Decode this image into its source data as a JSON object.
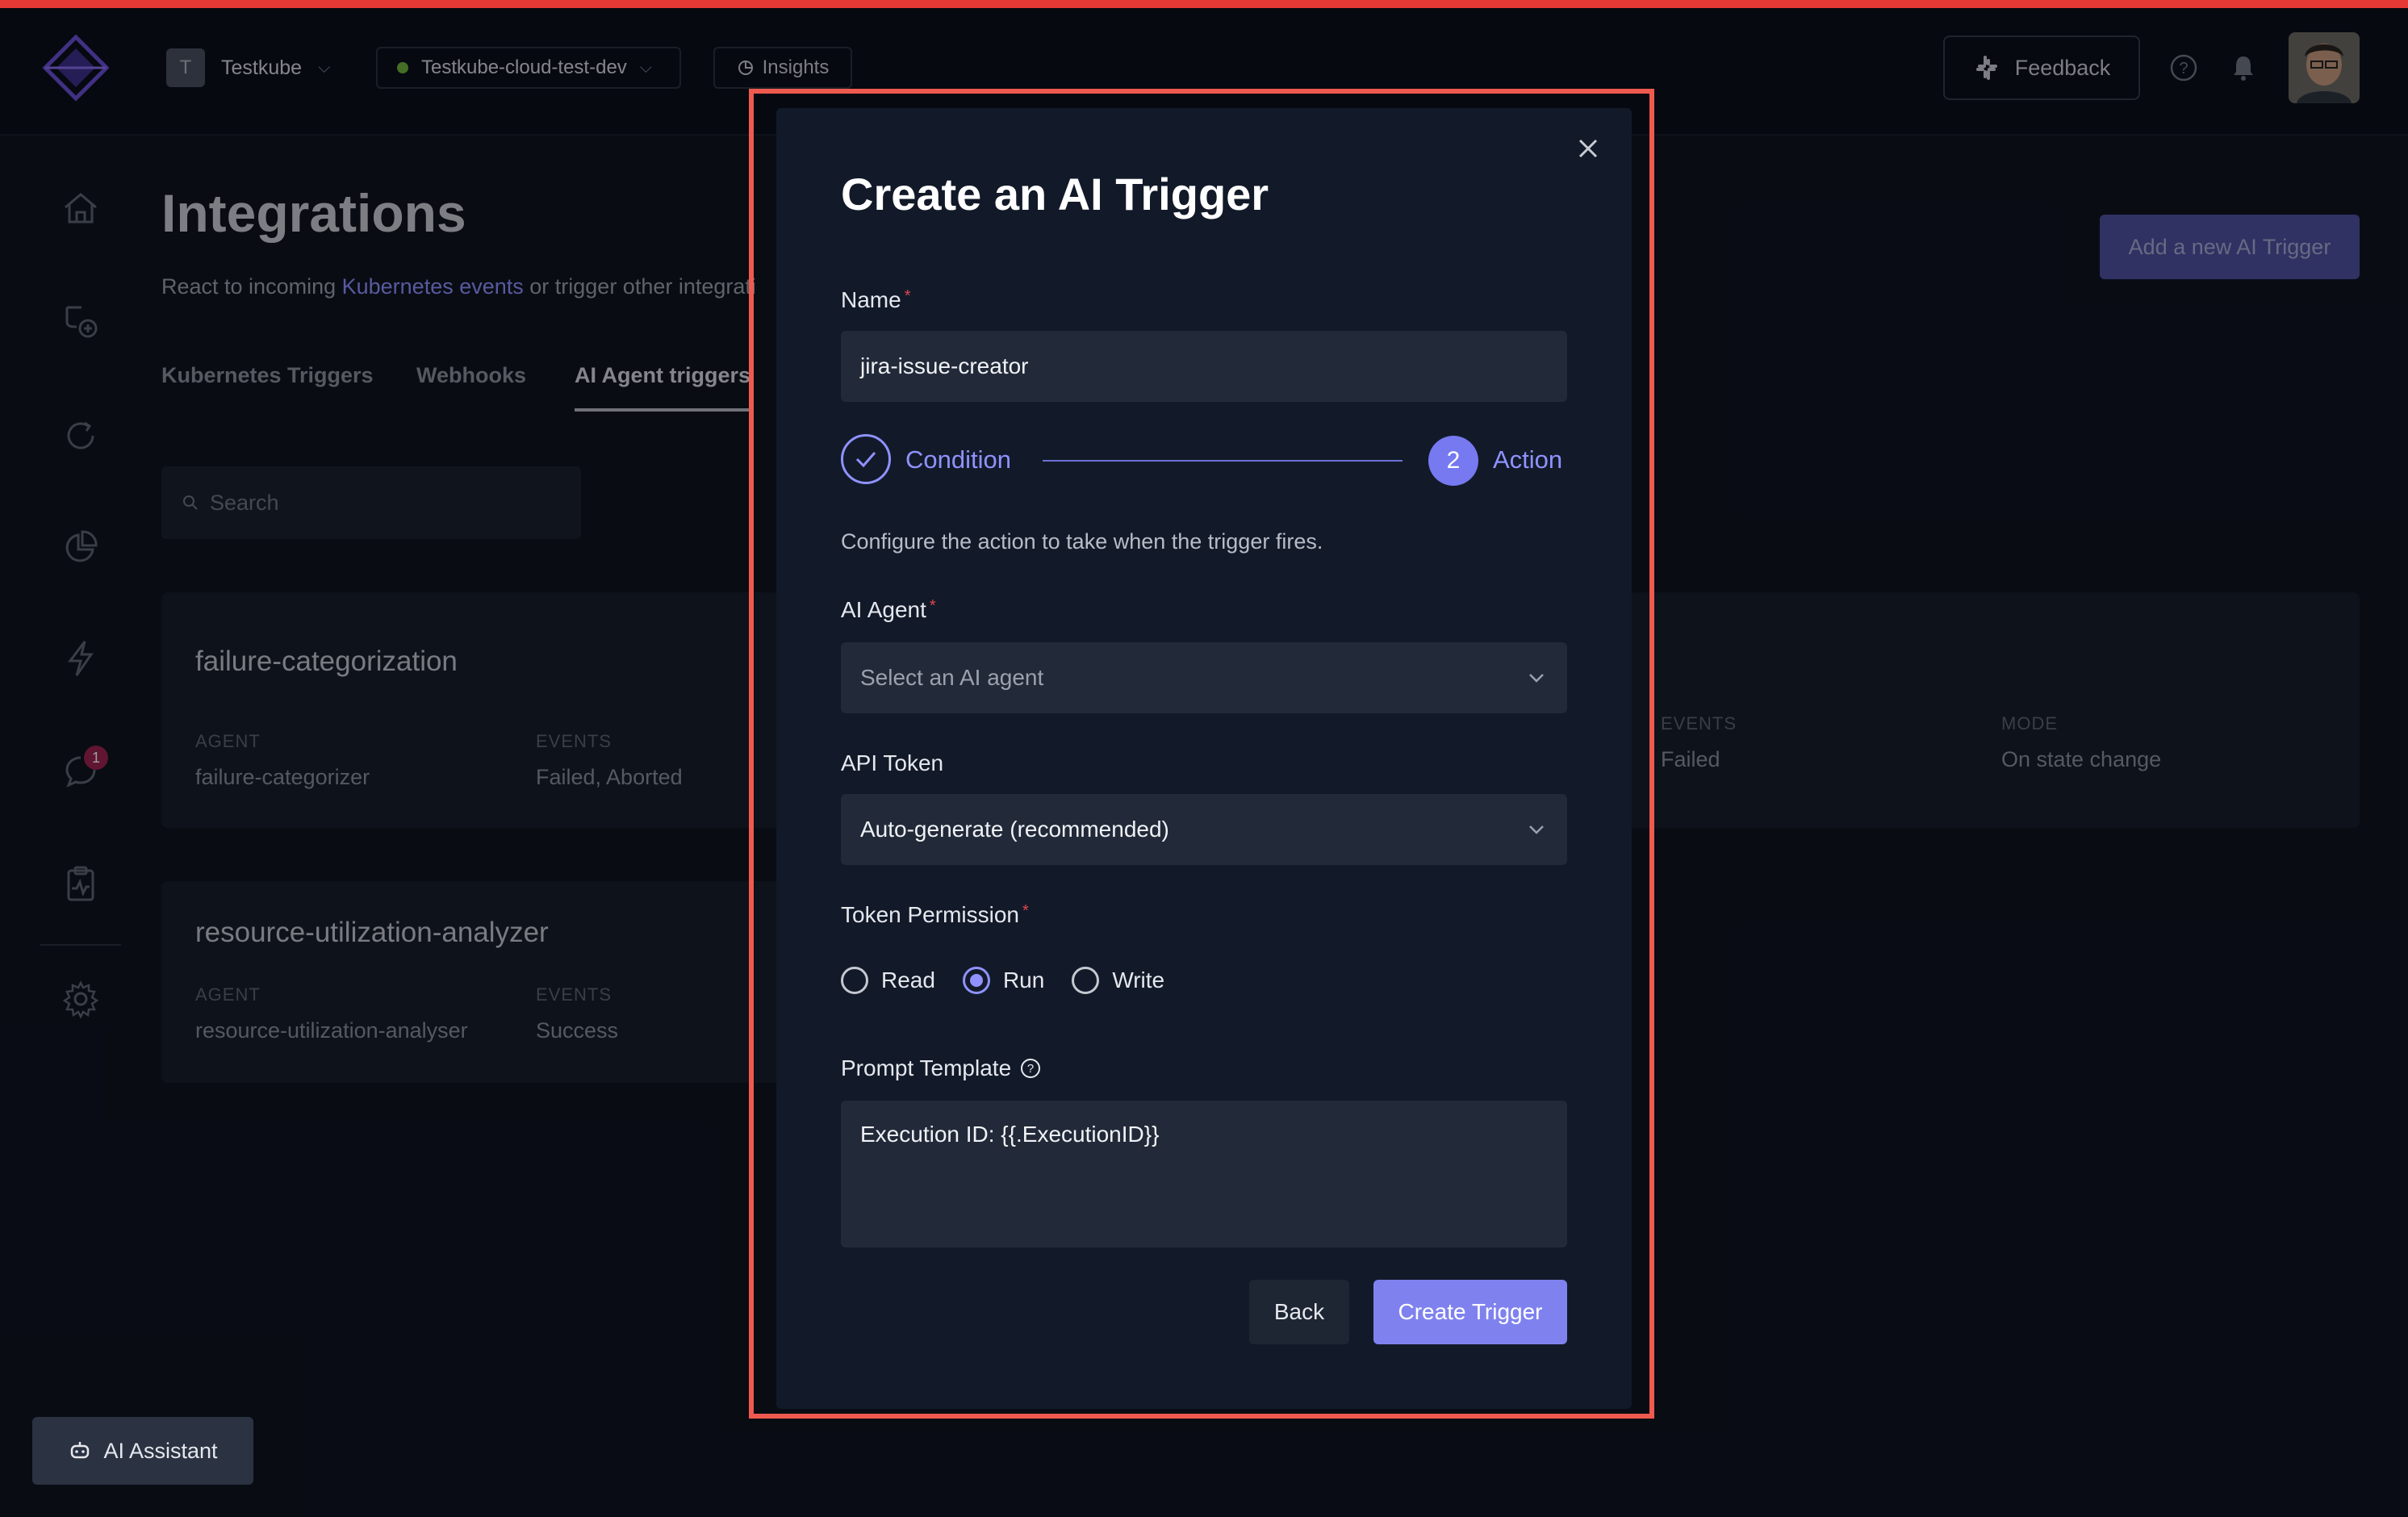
{
  "header": {
    "org": {
      "avatar_letter": "T",
      "name": "Testkube"
    },
    "environment": {
      "name": "Testkube-cloud-test-dev",
      "status_color": "#6fb23c"
    },
    "insights_label": "Insights",
    "feedback_label": "Feedback"
  },
  "sidebar": {
    "items": [
      {
        "icon": "home-icon"
      },
      {
        "icon": "add-workflow-icon"
      },
      {
        "icon": "refresh-icon"
      },
      {
        "icon": "pie-chart-icon"
      },
      {
        "icon": "lightning-icon"
      },
      {
        "icon": "chat-icon",
        "badge": "1"
      },
      {
        "icon": "clipboard-chart-icon"
      },
      {
        "icon": "gear-icon"
      }
    ]
  },
  "page": {
    "title": "Integrations",
    "subtitle_prefix": "React to incoming ",
    "subtitle_link": "Kubernetes events",
    "subtitle_suffix": " or trigger other integrati",
    "add_button_label": "Add a new AI Trigger",
    "tabs": [
      {
        "label": "Kubernetes Triggers",
        "active": false
      },
      {
        "label": "Webhooks",
        "active": false
      },
      {
        "label": "AI Agent triggers",
        "active": true
      }
    ],
    "search_placeholder": "Search"
  },
  "triggers": [
    {
      "name": "failure-categorization",
      "agent_label": "AGENT",
      "agent": "failure-categorizer",
      "events_label": "EVENTS",
      "events": "Failed, Aborted"
    },
    {
      "name": "resource-utilization-analyzer",
      "agent_label": "AGENT",
      "agent": "resource-utilization-analyser",
      "events_label": "EVENTS",
      "events": "Success"
    }
  ],
  "partial_card": {
    "events_label": "EVENTS",
    "events": "Failed",
    "mode_label": "MODE",
    "mode": "On state change"
  },
  "modal": {
    "title": "Create an AI Trigger",
    "name_label": "Name",
    "name_value": "jira-issue-creator",
    "steps": [
      {
        "label": "Condition",
        "state": "done"
      },
      {
        "number": "2",
        "label": "Action",
        "state": "current"
      }
    ],
    "step_description": "Configure the action to take when the trigger fires.",
    "agent_label": "AI Agent",
    "agent_placeholder": "Select an AI agent",
    "token_label": "API Token",
    "token_value": "Auto-generate (recommended)",
    "permission_label": "Token Permission",
    "permissions": [
      {
        "label": "Read",
        "checked": false
      },
      {
        "label": "Run",
        "checked": true
      },
      {
        "label": "Write",
        "checked": false
      }
    ],
    "prompt_label": "Prompt Template",
    "prompt_value": "Execution ID: {{.ExecutionID}}",
    "back_label": "Back",
    "create_label": "Create Trigger"
  },
  "ai_assistant_label": "AI Assistant",
  "colors": {
    "accent": "#7f82ee",
    "highlight_border": "#ef5a4f",
    "background": "#0f1420"
  }
}
